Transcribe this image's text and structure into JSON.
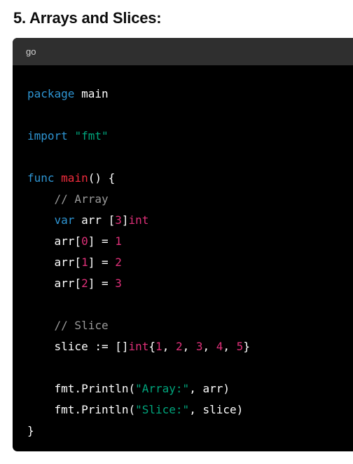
{
  "heading": "5. Arrays and Slices:",
  "code_block": {
    "language": "go",
    "lines": [
      [
        {
          "t": "package",
          "c": "kw"
        },
        {
          "t": " main",
          "c": "plain"
        }
      ],
      [],
      [
        {
          "t": "import",
          "c": "kw"
        },
        {
          "t": " ",
          "c": "plain"
        },
        {
          "t": "\"fmt\"",
          "c": "str"
        }
      ],
      [],
      [
        {
          "t": "func",
          "c": "kw"
        },
        {
          "t": " ",
          "c": "plain"
        },
        {
          "t": "main",
          "c": "fn"
        },
        {
          "t": "() {",
          "c": "plain"
        }
      ],
      [
        {
          "t": "    ",
          "c": "plain"
        },
        {
          "t": "// Array",
          "c": "cm"
        }
      ],
      [
        {
          "t": "    ",
          "c": "plain"
        },
        {
          "t": "var",
          "c": "kw"
        },
        {
          "t": " arr [",
          "c": "plain"
        },
        {
          "t": "3",
          "c": "num"
        },
        {
          "t": "]",
          "c": "plain"
        },
        {
          "t": "int",
          "c": "type"
        }
      ],
      [
        {
          "t": "    arr[",
          "c": "plain"
        },
        {
          "t": "0",
          "c": "num"
        },
        {
          "t": "] = ",
          "c": "plain"
        },
        {
          "t": "1",
          "c": "num"
        }
      ],
      [
        {
          "t": "    arr[",
          "c": "plain"
        },
        {
          "t": "1",
          "c": "num"
        },
        {
          "t": "] = ",
          "c": "plain"
        },
        {
          "t": "2",
          "c": "num"
        }
      ],
      [
        {
          "t": "    arr[",
          "c": "plain"
        },
        {
          "t": "2",
          "c": "num"
        },
        {
          "t": "] = ",
          "c": "plain"
        },
        {
          "t": "3",
          "c": "num"
        }
      ],
      [],
      [
        {
          "t": "    ",
          "c": "plain"
        },
        {
          "t": "// Slice",
          "c": "cm"
        }
      ],
      [
        {
          "t": "    slice := []",
          "c": "plain"
        },
        {
          "t": "int",
          "c": "type"
        },
        {
          "t": "{",
          "c": "plain"
        },
        {
          "t": "1",
          "c": "num"
        },
        {
          "t": ", ",
          "c": "plain"
        },
        {
          "t": "2",
          "c": "num"
        },
        {
          "t": ", ",
          "c": "plain"
        },
        {
          "t": "3",
          "c": "num"
        },
        {
          "t": ", ",
          "c": "plain"
        },
        {
          "t": "4",
          "c": "num"
        },
        {
          "t": ", ",
          "c": "plain"
        },
        {
          "t": "5",
          "c": "num"
        },
        {
          "t": "}",
          "c": "plain"
        }
      ],
      [],
      [
        {
          "t": "    fmt.Println(",
          "c": "plain"
        },
        {
          "t": "\"Array:\"",
          "c": "str"
        },
        {
          "t": ", arr)",
          "c": "plain"
        }
      ],
      [
        {
          "t": "    fmt.Println(",
          "c": "plain"
        },
        {
          "t": "\"Slice:\"",
          "c": "str"
        },
        {
          "t": ", slice)",
          "c": "plain"
        }
      ],
      [
        {
          "t": "}",
          "c": "plain"
        }
      ]
    ]
  },
  "colors": {
    "keyword": "#2e95d3",
    "string": "#00a67d",
    "function": "#f22c3d",
    "number": "#df3079",
    "comment": "#9a9a9a",
    "code_background": "#000000",
    "code_header_background": "#2f2f2f"
  }
}
